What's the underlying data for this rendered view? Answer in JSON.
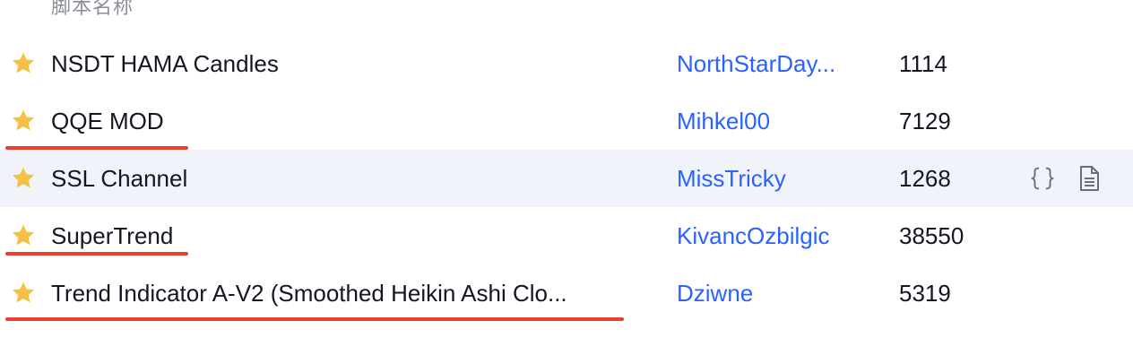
{
  "header": {
    "label": "脚本名称"
  },
  "rows": [
    {
      "name": "NSDT HAMA Candles",
      "author": "NorthStarDay...",
      "count": "1114",
      "favorite": true,
      "underlined": false,
      "hovered": false
    },
    {
      "name": "QQE MOD",
      "author": "Mihkel00",
      "count": "7129",
      "favorite": true,
      "underlined": true,
      "hovered": false
    },
    {
      "name": "SSL Channel",
      "author": "MissTricky",
      "count": "1268",
      "favorite": true,
      "underlined": false,
      "hovered": true
    },
    {
      "name": "SuperTrend",
      "author": "KivancOzbilgic",
      "count": "38550",
      "favorite": true,
      "underlined": true,
      "hovered": false
    },
    {
      "name": "Trend Indicator A-V2 (Smoothed Heikin Ashi Clo...",
      "author": "Dziwne",
      "count": "5319",
      "favorite": true,
      "underlined": true,
      "hovered": false
    }
  ],
  "row_actions": {
    "source_icon": "code-braces-icon",
    "doc_icon": "document-icon"
  },
  "colors": {
    "star": "#f5c144",
    "author": "#2962ff",
    "underline": "#e8402d",
    "hover_bg": "#f0f3fa"
  }
}
